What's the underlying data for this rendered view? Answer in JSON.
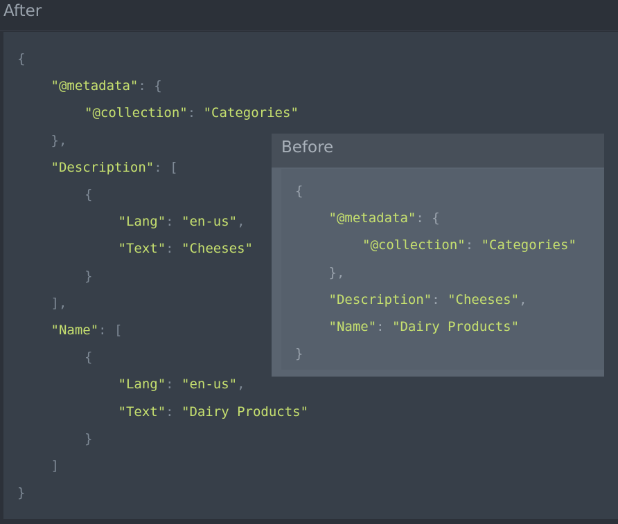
{
  "after": {
    "title": "After",
    "lines": [
      {
        "punc_pre": "{",
        "key": "",
        "sep": "",
        "value": "",
        "punc_post": ""
      },
      {
        "punc_pre": "",
        "key": "\"@metadata\"",
        "sep": ": ",
        "value": "",
        "punc_post": "{"
      },
      {
        "punc_pre": "",
        "key": "\"@collection\"",
        "sep": ": ",
        "value": "\"Categories\"",
        "punc_post": ""
      },
      {
        "punc_pre": "},",
        "key": "",
        "sep": "",
        "value": "",
        "punc_post": ""
      },
      {
        "punc_pre": "",
        "key": "\"Description\"",
        "sep": ": ",
        "value": "",
        "punc_post": "["
      },
      {
        "punc_pre": "{",
        "key": "",
        "sep": "",
        "value": "",
        "punc_post": ""
      },
      {
        "punc_pre": "",
        "key": "\"Lang\"",
        "sep": ": ",
        "value": "\"en-us\"",
        "punc_post": ","
      },
      {
        "punc_pre": "",
        "key": "\"Text\"",
        "sep": ": ",
        "value": "\"Cheeses\"",
        "punc_post": ""
      },
      {
        "punc_pre": "}",
        "key": "",
        "sep": "",
        "value": "",
        "punc_post": ""
      },
      {
        "punc_pre": "],",
        "key": "",
        "sep": "",
        "value": "",
        "punc_post": ""
      },
      {
        "punc_pre": "",
        "key": "\"Name\"",
        "sep": ": ",
        "value": "",
        "punc_post": "["
      },
      {
        "punc_pre": "{",
        "key": "",
        "sep": "",
        "value": "",
        "punc_post": ""
      },
      {
        "punc_pre": "",
        "key": "\"Lang\"",
        "sep": ": ",
        "value": "\"en-us\"",
        "punc_post": ","
      },
      {
        "punc_pre": "",
        "key": "\"Text\"",
        "sep": ": ",
        "value": "\"Dairy Products\"",
        "punc_post": ""
      },
      {
        "punc_pre": "}",
        "key": "",
        "sep": "",
        "value": "",
        "punc_post": ""
      },
      {
        "punc_pre": "]",
        "key": "",
        "sep": "",
        "value": "",
        "punc_post": ""
      },
      {
        "punc_pre": "}",
        "key": "",
        "sep": "",
        "value": "",
        "punc_post": ""
      }
    ]
  },
  "before": {
    "title": "Before",
    "lines": [
      {
        "punc_pre": "{",
        "key": "",
        "sep": "",
        "value": "",
        "punc_post": ""
      },
      {
        "punc_pre": "",
        "key": "\"@metadata\"",
        "sep": ": ",
        "value": "",
        "punc_post": "{"
      },
      {
        "punc_pre": "",
        "key": "\"@collection\"",
        "sep": ": ",
        "value": "\"Categories\"",
        "punc_post": ""
      },
      {
        "punc_pre": "},",
        "key": "",
        "sep": "",
        "value": "",
        "punc_post": ""
      },
      {
        "punc_pre": "",
        "key": "\"Description\"",
        "sep": ": ",
        "value": "\"Cheeses\"",
        "punc_post": ","
      },
      {
        "punc_pre": "",
        "key": "\"Name\"",
        "sep": ": ",
        "value": "\"Dairy Products\"",
        "punc_post": ""
      },
      {
        "punc_pre": "}",
        "key": "",
        "sep": "",
        "value": "",
        "punc_post": ""
      }
    ]
  },
  "colors": {
    "key": "#c6e06f",
    "punctuation": "#7f8a96"
  }
}
